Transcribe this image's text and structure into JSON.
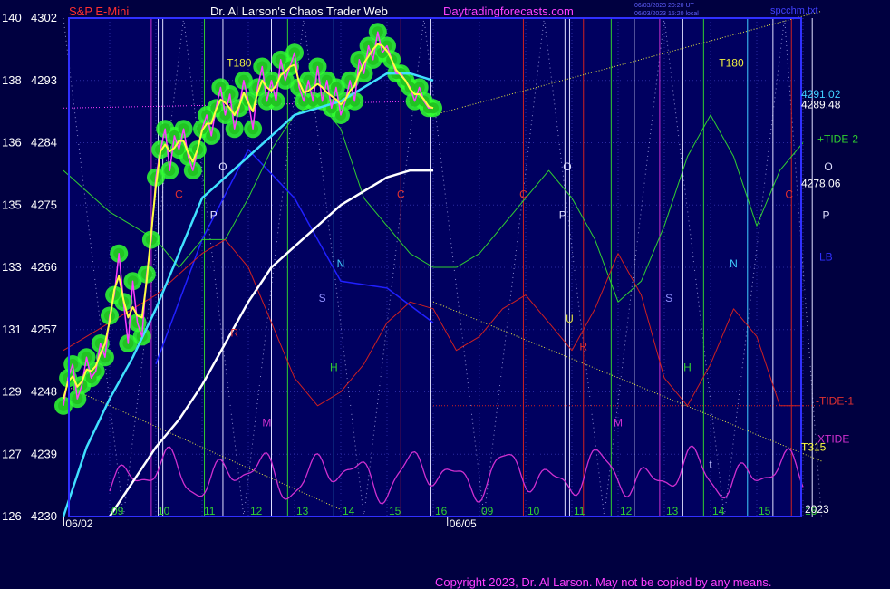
{
  "header": {
    "instrument": "S&P E-Mini",
    "title": "Dr. Al Larson's Chaos Trader Web",
    "website": "Daytradingforecasts.com",
    "filename": "spcchm.txt",
    "timestamp1": "06/03/2023 20:20 UT",
    "timestamp2": "06/03/2023 15:20 local"
  },
  "copyright": "Copyright 2023, Dr. Al Larson. May not be copied by any means.",
  "colors": {
    "background": "#000040",
    "plot_background": "#000060",
    "frame": "#3030ff",
    "grid": "#2a2aa0",
    "price_yellow": "#ffff40",
    "price_magenta": "#ff40ff",
    "glow_green": "#30ff30",
    "cyan_ma": "#40e0ff",
    "white_ma": "#ffffff",
    "blue_line": "#2020ff",
    "tide2": "#30d030",
    "tide1": "#d02020",
    "xtide": "#d030d0",
    "trend_dotted": "#e8e840",
    "vline_red": "#d02020",
    "vline_white": "#e0e0ff",
    "vline_cyan": "#40d0ff",
    "vline_green": "#30d030",
    "vline_magenta": "#d030d0"
  },
  "chart_data": {
    "type": "line",
    "title": "S&P E-Mini",
    "ylim_price": [
      4230,
      4302
    ],
    "left_axis": [
      {
        "osc": "140",
        "price": "4302"
      },
      {
        "osc": "138",
        "price": "4293"
      },
      {
        "osc": "136",
        "price": "4284"
      },
      {
        "osc": "135",
        "price": "4275"
      },
      {
        "osc": "133",
        "price": "4266"
      },
      {
        "osc": "131",
        "price": "4257"
      },
      {
        "osc": "129",
        "price": "4248"
      },
      {
        "osc": "127",
        "price": "4239"
      },
      {
        "osc": "126",
        "price": "4230"
      }
    ],
    "xlim_hours": [
      0,
      32.7
    ],
    "x_ticks": [
      {
        "label": "09",
        "h": 1.0
      },
      {
        "label": "10",
        "h": 2.0
      },
      {
        "label": "11",
        "h": 3.0
      },
      {
        "label": "12",
        "h": 4.0
      },
      {
        "label": "13",
        "h": 5.0
      },
      {
        "label": "14",
        "h": 6.0
      },
      {
        "label": "15",
        "h": 7.0
      },
      {
        "label": "16",
        "h": 8.0
      },
      {
        "label": "09",
        "h": 9.0
      },
      {
        "label": "10",
        "h": 10.0
      },
      {
        "label": "11",
        "h": 11.0
      },
      {
        "label": "12",
        "h": 12.0
      },
      {
        "label": "13",
        "h": 13.0
      },
      {
        "label": "14",
        "h": 14.0
      },
      {
        "label": "15",
        "h": 15.0
      },
      {
        "label": "16",
        "h": 16.0
      }
    ],
    "date_labels": [
      {
        "label": "06/02",
        "h": 0.4
      },
      {
        "label": "06/05",
        "h": 8.7
      }
    ],
    "year_label": "2023",
    "price_series": {
      "name": "S&P E-Mini",
      "h": [
        0.0,
        0.1,
        0.2,
        0.3,
        0.4,
        0.5,
        0.6,
        0.7,
        0.8,
        0.9,
        1.0,
        1.1,
        1.2,
        1.3,
        1.4,
        1.5,
        1.6,
        1.7,
        1.8,
        1.9,
        2.0,
        2.1,
        2.2,
        2.3,
        2.4,
        2.5,
        2.6,
        2.7,
        2.8,
        2.9,
        3.0,
        3.1,
        3.2,
        3.3,
        3.4,
        3.5,
        3.6,
        3.7,
        3.8,
        3.9,
        4.0,
        4.1,
        4.2,
        4.3,
        4.4,
        4.5,
        4.6,
        4.7,
        4.8,
        4.9,
        5.0,
        5.1,
        5.2,
        5.3,
        5.4,
        5.5,
        5.6,
        5.7,
        5.8,
        5.9,
        6.0,
        6.1,
        6.2,
        6.3,
        6.4,
        6.5,
        6.6,
        6.7,
        6.8,
        6.9,
        7.0,
        7.1,
        7.2,
        7.3,
        7.4,
        7.5,
        7.6,
        7.7,
        7.8,
        7.9,
        8.0
      ],
      "v": [
        4246,
        4250,
        4252,
        4247,
        4249,
        4253,
        4250,
        4251,
        4255,
        4253,
        4259,
        4262,
        4268,
        4261,
        4255,
        4264,
        4258,
        4256,
        4265,
        4270,
        4279,
        4283,
        4286,
        4280,
        4285,
        4283,
        4286,
        4282,
        4280,
        4283,
        4286,
        4288,
        4285,
        4289,
        4292,
        4288,
        4291,
        4286,
        4289,
        4293,
        4290,
        4286,
        4292,
        4295,
        4290,
        4293,
        4290,
        4296,
        4293,
        4295,
        4297,
        4292,
        4290,
        4293,
        4290,
        4295,
        4290,
        4293,
        4289,
        4292,
        4288,
        4290,
        4293,
        4290,
        4296,
        4294,
        4298,
        4296,
        4300,
        4297,
        4298,
        4296,
        4294,
        4294,
        4293,
        4292,
        4290,
        4292,
        4290,
        4289,
        4289
      ]
    },
    "cyan_ma": {
      "h": [
        0.0,
        0.5,
        1.0,
        1.5,
        2.0,
        2.5,
        3.0,
        3.5,
        4.0,
        4.5,
        5.0,
        5.5,
        6.0,
        6.5,
        7.0,
        7.5,
        8.0
      ],
      "v": [
        4230,
        4240,
        4247,
        4253,
        4260,
        4268,
        4276,
        4279,
        4282,
        4285,
        4288,
        4289,
        4290,
        4292,
        4294,
        4294,
        4293
      ]
    },
    "white_ma": {
      "h": [
        1.0,
        1.5,
        2.0,
        2.5,
        3.0,
        3.5,
        4.0,
        4.5,
        5.0,
        5.5,
        6.0,
        6.5,
        7.0,
        7.5,
        8.0
      ],
      "v": [
        4230,
        4235,
        4240,
        4244,
        4249,
        4255,
        4261,
        4266,
        4269,
        4272,
        4275,
        4277,
        4279,
        4280,
        4280
      ]
    },
    "tide2": {
      "name": "+TIDE-2",
      "h": [
        0,
        1,
        2,
        2.5,
        3,
        3.5,
        4,
        4.5,
        5,
        5.5,
        6,
        6.5,
        7,
        7.5,
        8,
        8.5,
        9,
        9.5,
        10,
        10.5,
        11,
        11.5,
        12,
        12.5,
        13,
        13.5,
        14,
        14.5,
        15,
        15.5,
        16
      ],
      "v": [
        4280,
        4274,
        4270,
        4266,
        4270,
        4270,
        4276,
        4283,
        4288,
        4290,
        4286,
        4276,
        4272,
        4268,
        4266,
        4266,
        4268,
        4272,
        4276,
        4280,
        4276,
        4270,
        4261,
        4264,
        4272,
        4282,
        4288,
        4282,
        4272,
        4280,
        4284
      ]
    },
    "tide1": {
      "name": "-TIDE-1",
      "h": [
        0,
        1,
        2,
        2.5,
        3,
        3.5,
        4,
        4.5,
        5,
        5.5,
        6,
        6.5,
        7,
        7.5,
        8,
        8.5,
        9,
        9.5,
        10,
        10.5,
        11,
        11.5,
        12,
        12.5,
        13,
        13.5,
        14,
        14.5,
        15,
        15.5,
        16
      ],
      "v": [
        4254,
        4258,
        4262,
        4265,
        4268,
        4270,
        4266,
        4258,
        4250,
        4246,
        4248,
        4252,
        4258,
        4261,
        4260,
        4254,
        4256,
        4260,
        4262,
        4258,
        4254,
        4260,
        4268,
        4262,
        4250,
        4246,
        4252,
        4260,
        4256,
        4246,
        4246
      ]
    },
    "xtide": {
      "name": "XTIDE",
      "base_price": 4236,
      "amp": 4.5,
      "segment1_h": [
        1.0,
        8.0
      ],
      "segment2_h": [
        8.0,
        16.0
      ]
    },
    "blue_line": {
      "h": [
        2,
        3,
        4,
        5,
        6,
        7,
        8
      ],
      "v": [
        4252,
        4270,
        4283,
        4276,
        4264,
        4263,
        4258
      ]
    },
    "trend_lines": [
      {
        "h": [
          8.0,
          16.4
        ],
        "v": [
          4288,
          4303
        ]
      },
      {
        "h": [
          8.0,
          16.4
        ],
        "v": [
          4261,
          4238
        ]
      },
      {
        "h": [
          0.0,
          6.0
        ],
        "v": [
          4249,
          4231
        ]
      }
    ],
    "flat_lines": [
      {
        "color": "magenta",
        "h": [
          0,
          8.0
        ],
        "v": [
          4289,
          4290
        ]
      },
      {
        "color": "red",
        "h": [
          8.0,
          16.4
        ],
        "v": [
          4246,
          4246
        ]
      },
      {
        "color": "red",
        "h": [
          0,
          3.0
        ],
        "v": [
          4237,
          4237
        ]
      }
    ],
    "vlines": [
      {
        "h": 1.9,
        "color": "magenta"
      },
      {
        "h": 2.05,
        "color": "white"
      },
      {
        "h": 2.15,
        "color": "white"
      },
      {
        "h": 2.5,
        "color": "red"
      },
      {
        "h": 3.05,
        "color": "green"
      },
      {
        "h": 3.45,
        "color": "white"
      },
      {
        "h": 4.5,
        "color": "white"
      },
      {
        "h": 4.85,
        "color": "green"
      },
      {
        "h": 5.85,
        "color": "cyan"
      },
      {
        "h": 7.3,
        "color": "red"
      },
      {
        "h": 7.95,
        "color": "white"
      },
      {
        "h": 9.95,
        "color": "red"
      },
      {
        "h": 10.85,
        "color": "white"
      },
      {
        "h": 10.95,
        "color": "white"
      },
      {
        "h": 11.25,
        "color": "red"
      },
      {
        "h": 11.85,
        "color": "green"
      },
      {
        "h": 12.35,
        "color": "white"
      },
      {
        "h": 12.9,
        "color": "magenta"
      },
      {
        "h": 13.4,
        "color": "white"
      },
      {
        "h": 13.85,
        "color": "green"
      },
      {
        "h": 14.8,
        "color": "cyan"
      },
      {
        "h": 15.35,
        "color": "white"
      },
      {
        "h": 15.75,
        "color": "red"
      },
      {
        "h": 16.2,
        "color": "white"
      }
    ],
    "right_labels": [
      {
        "text": "4291.02",
        "price": 4291.0
      },
      {
        "text": "4289.48",
        "price": 4289.5
      },
      {
        "text": "+TIDE-2",
        "price": 4284.5
      },
      {
        "text": "4278.06",
        "price": 4278.1
      },
      {
        "text": "LB",
        "price": 4267.5
      },
      {
        "text": "-TIDE-1",
        "price": 4246.7
      },
      {
        "text": "XTIDE",
        "price": 4241.2
      },
      {
        "text": "T315",
        "price": 4240.0
      }
    ],
    "annotations": [
      {
        "text": "T180",
        "h": 3.8,
        "price": 4295,
        "color": "#f0f040"
      },
      {
        "text": "T180",
        "h": 14.45,
        "price": 4295,
        "color": "#f0f040"
      },
      {
        "text": "C",
        "h": 2.5,
        "price": 4276,
        "color": "#e03030"
      },
      {
        "text": "C",
        "h": 7.3,
        "price": 4276,
        "color": "#e03030"
      },
      {
        "text": "C",
        "h": 9.95,
        "price": 4276,
        "color": "#e03030"
      },
      {
        "text": "C",
        "h": 15.7,
        "price": 4276,
        "color": "#e03030"
      },
      {
        "text": "O",
        "h": 3.45,
        "price": 4280,
        "color": "#e0e0ff"
      },
      {
        "text": "O",
        "h": 10.9,
        "price": 4280,
        "color": "#e0e0ff"
      },
      {
        "text": "O",
        "h": 16.55,
        "price": 4280,
        "color": "#e0e0ff"
      },
      {
        "text": "P",
        "h": 3.25,
        "price": 4273,
        "color": "#e0e0ff"
      },
      {
        "text": "P",
        "h": 10.8,
        "price": 4273,
        "color": "#e0e0ff"
      },
      {
        "text": "P",
        "h": 16.5,
        "price": 4273,
        "color": "#e0e0ff"
      },
      {
        "text": "N",
        "h": 6.0,
        "price": 4266,
        "color": "#40d0ff"
      },
      {
        "text": "N",
        "h": 14.5,
        "price": 4266,
        "color": "#40d0ff"
      },
      {
        "text": "S",
        "h": 5.6,
        "price": 4261,
        "color": "#9090ff"
      },
      {
        "text": "S",
        "h": 13.1,
        "price": 4261,
        "color": "#9090ff"
      },
      {
        "text": "H",
        "h": 5.85,
        "price": 4251,
        "color": "#30d030"
      },
      {
        "text": "H",
        "h": 13.5,
        "price": 4251,
        "color": "#30d030"
      },
      {
        "text": "M",
        "h": 4.4,
        "price": 4243,
        "color": "#d030d0"
      },
      {
        "text": "M",
        "h": 12.0,
        "price": 4243,
        "color": "#d030d0"
      },
      {
        "text": "R",
        "h": 3.7,
        "price": 4256,
        "color": "#e03030"
      },
      {
        "text": "R",
        "h": 11.25,
        "price": 4254,
        "color": "#e03030"
      },
      {
        "text": "U",
        "h": 10.95,
        "price": 4258,
        "color": "#e0e040"
      },
      {
        "text": "t",
        "h": 14.0,
        "price": 4237,
        "color": "#c0c0ff"
      }
    ]
  }
}
